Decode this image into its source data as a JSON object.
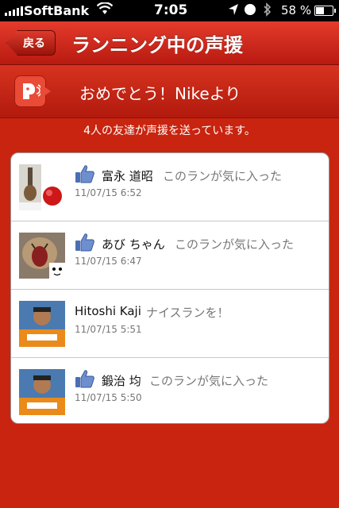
{
  "status_bar": {
    "carrier": "SoftBank",
    "time": "7:05",
    "battery_percent": "58 %",
    "battery_level": 0.58
  },
  "nav": {
    "back_label": "戻る",
    "title": "ランニング中の声援"
  },
  "banner": {
    "text": "おめでとう！Nikeより"
  },
  "subtitle": "4人の友達が声援を送っています。",
  "cheers": [
    {
      "name": "富永 道昭",
      "message": "このランが気に入った",
      "timestamp": "11/07/15  6:52",
      "liked": true
    },
    {
      "name": "あび ちゃん",
      "message": "このランが気に入った",
      "timestamp": "11/07/15  6:47",
      "liked": true
    },
    {
      "name": "Hitoshi Kaji",
      "message": "ナイスランを！",
      "timestamp": "11/07/15  5:51",
      "liked": false
    },
    {
      "name": "鍛治 均",
      "message": "このランが気に入った",
      "timestamp": "11/07/15  5:50",
      "liked": true
    }
  ],
  "colors": {
    "background": "#c8240f",
    "navbar": "#d02a1c",
    "like_icon": "#3b5998"
  }
}
